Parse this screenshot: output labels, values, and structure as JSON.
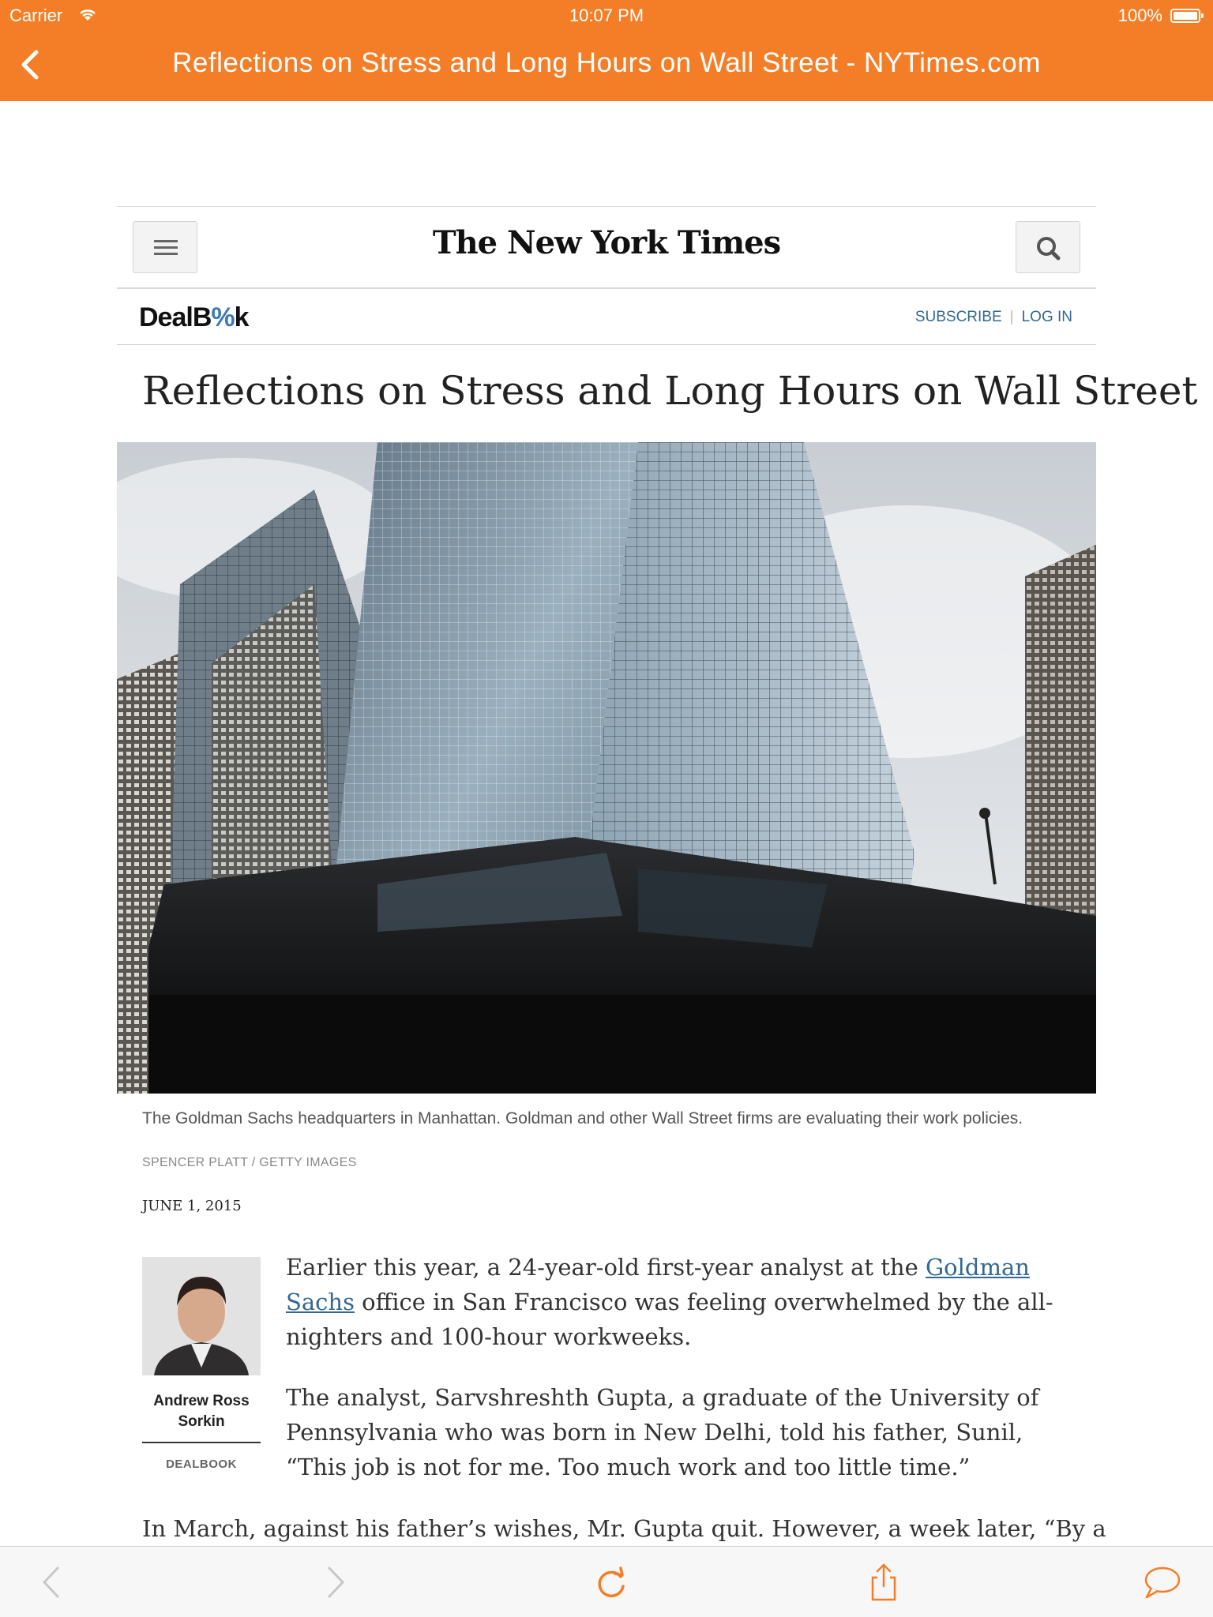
{
  "status_bar": {
    "carrier": "Carrier",
    "time": "10:07 PM",
    "battery": "100%"
  },
  "nav_bar": {
    "title": "Reflections on Stress and Long Hours on Wall Street - NYTimes.com",
    "back_icon": "chevron-left-icon",
    "accent_color": "#f47e27"
  },
  "site_header": {
    "masthead": "The New York Times",
    "menu_icon": "hamburger-icon",
    "search_icon": "search-icon"
  },
  "section_bar": {
    "logo_pre": "DealB",
    "logo_mid": "%",
    "logo_post": "k",
    "subscribe": "SUBSCRIBE",
    "login": "LOG IN"
  },
  "article": {
    "headline": "Reflections on Stress and Long Hours on Wall Street",
    "caption": "The Goldman Sachs headquarters in Manhattan. Goldman and other Wall Street firms are evaluating their work policies.",
    "credit": "SPENCER PLATT / GETTY IMAGES",
    "date": "JUNE 1, 2015",
    "author_name": "Andrew Ross Sorkin",
    "author_section": "DEALBOOK",
    "p1_before": "Earlier this year, a 24-year-old first-year analyst at the ",
    "p1_link": "Goldman Sachs",
    "p1_after": " office in San Francisco was feeling overwhelmed by the all-nighters and 100-hour workweeks.",
    "p2": "The analyst, Sarvshreshth Gupta, a graduate of the University of Pennsylvania who was born in New Delhi, told his father, Sunil, “This job is not for me. Too much work and too little time.”",
    "p3": "In March, against his father’s wishes, Mr. Gupta quit. However, a week later, “By a"
  },
  "toolbar": {
    "icons": [
      "back-arrow-icon",
      "forward-arrow-icon",
      "reload-icon",
      "share-icon",
      "comment-icon"
    ],
    "accent_color": "#f47e27"
  }
}
